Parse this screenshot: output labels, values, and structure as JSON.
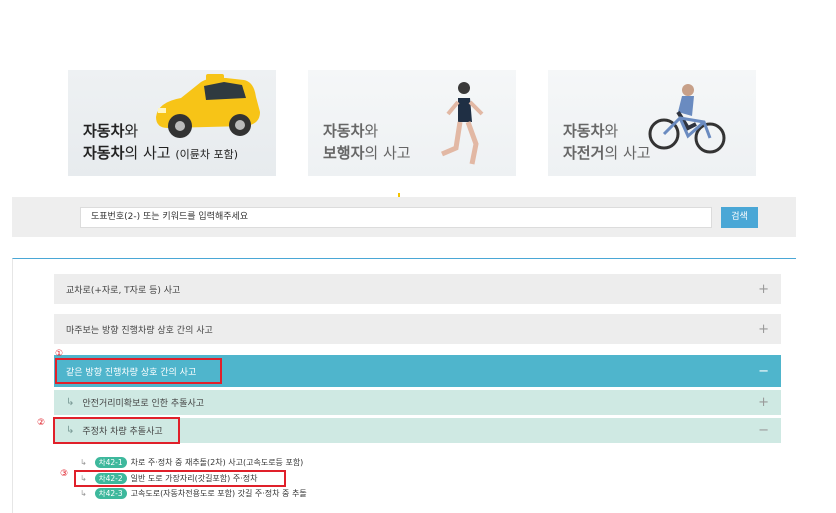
{
  "categories": [
    {
      "line1_bold": "자동차",
      "line1_rest": "와",
      "line2_bold": "자동차",
      "line2_rest": "의 사고 ",
      "line2_sub": "(이륜차 포함)",
      "icon": "car-icon"
    },
    {
      "line1_bold": "자동차",
      "line1_rest": "와",
      "line2_bold": "보행자",
      "line2_rest": "의 사고",
      "icon": "pedestrian-icon"
    },
    {
      "line1_bold": "자동차",
      "line1_rest": "와",
      "line2_bold": "자전거",
      "line2_rest": "의 사고",
      "icon": "bicycle-icon"
    }
  ],
  "search": {
    "placeholder": "도표번호(2-) 또는 키워드를 입력해주세요",
    "button_label": "검색"
  },
  "accordion": {
    "row1": {
      "label": "교차로(+자로, T자로 등) 사고",
      "toggle": "+"
    },
    "row2": {
      "label": "마주보는 방향 진행차량 상호 간의 사고",
      "toggle": "+"
    },
    "row3": {
      "label": "같은 방향 진행차량 상호 간의 사고",
      "toggle": "−"
    },
    "row4": {
      "arrow": "↳",
      "label": "안전거리미확보로 인한 추돌사고",
      "toggle": "+"
    },
    "row5": {
      "arrow": "↳",
      "label": "주정차 차량 추돌사고",
      "toggle": "−"
    }
  },
  "leaves": [
    {
      "arrow": "↳",
      "code": "차42-1",
      "label": "차로 주·정차 중 재추돌(2차) 사고(고속도로등 포함)"
    },
    {
      "arrow": "↳",
      "code": "차42-2",
      "label": "일반 도로 가장자리(갓길포함) 주·정차"
    },
    {
      "arrow": "↳",
      "code": "차42-3",
      "label": "고속도로(자동차전용도로 포함) 갓길 주·정차 중 추돌"
    }
  ],
  "annotations": {
    "mark1": "①",
    "mark2": "②",
    "mark3": "③"
  },
  "colors": {
    "accent_blue": "#4fb5cc",
    "mint": "#cfe9e3",
    "highlight_red": "#e0202a",
    "code_green": "#3db89c"
  }
}
